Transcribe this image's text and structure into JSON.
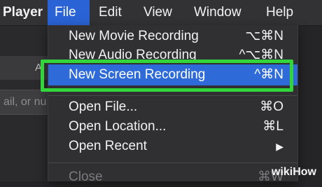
{
  "menubar": {
    "app": "Player",
    "items": [
      "File",
      "Edit",
      "View",
      "Window",
      "Help"
    ]
  },
  "background": {
    "search_placeholder": "ail, or nu",
    "toolbar_glyph": "A"
  },
  "file_menu": {
    "items": [
      {
        "label": "New Movie Recording",
        "shortcut": "⌥⌘N"
      },
      {
        "label": "New Audio Recording",
        "shortcut": "^⌥⌘N"
      },
      {
        "label": "New Screen Recording",
        "shortcut": "^⌘N"
      },
      {
        "label": "Open File...",
        "shortcut": "⌘O"
      },
      {
        "label": "Open Location...",
        "shortcut": "⌘L"
      },
      {
        "label": "Open Recent",
        "shortcut": "▶"
      },
      {
        "label": "Close",
        "shortcut": "⌘W"
      }
    ]
  },
  "watermark": {
    "wiki": "wiki",
    "how": "How"
  },
  "colors": {
    "highlight": "#2e6bd8",
    "callout": "#33d63a",
    "menubar_active": "#2a63d6"
  }
}
